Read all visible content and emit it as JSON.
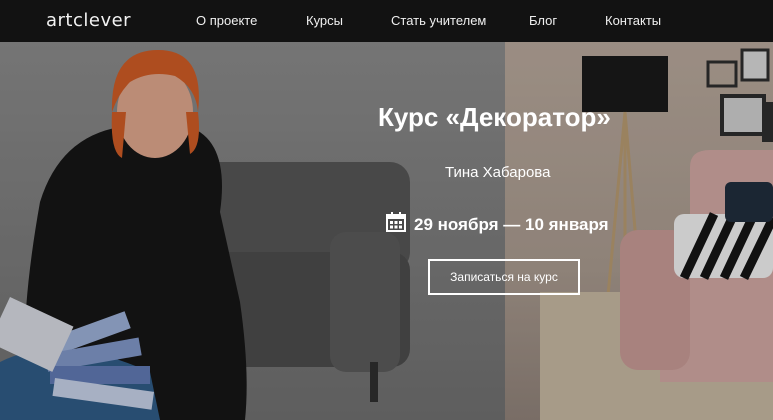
{
  "header": {
    "logo": "artclever",
    "nav": [
      {
        "label": "О проекте"
      },
      {
        "label": "Курсы"
      },
      {
        "label": "Стать учителем"
      },
      {
        "label": "Блог"
      },
      {
        "label": "Контакты"
      }
    ]
  },
  "hero": {
    "title": "Курс «Декоратор»",
    "author": "Тина Хабарова",
    "dates": "29 ноября — 10 января",
    "cta_label": "Записаться на курс"
  },
  "colors": {
    "nav_background": "#121212",
    "text": "#ffffff"
  },
  "icons": {
    "dates_icon": "calendar-icon"
  }
}
